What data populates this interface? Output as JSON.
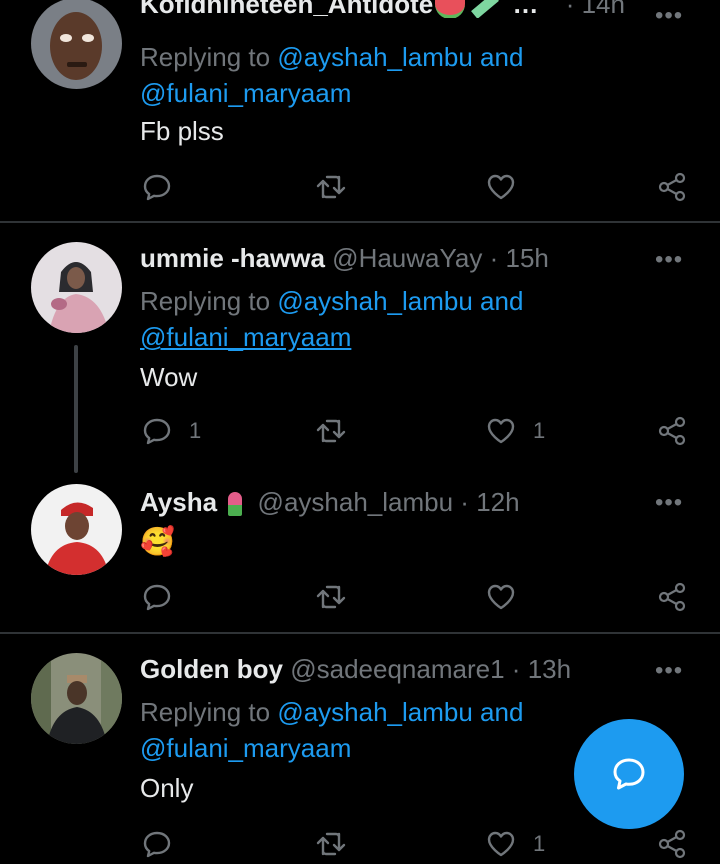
{
  "tweets": [
    {
      "name": "Kofidnineteen_Antidote",
      "handle": "…",
      "time": "14h",
      "replying_prefix": "Replying to",
      "replying_line1": "@ayshah_lambu and",
      "replying_line2": "@fulani_maryaam",
      "text": "Fb plss",
      "reply_count": "",
      "like_count": ""
    },
    {
      "name": "ummie -hawwa",
      "handle": "@HauwaYay",
      "time": "15h",
      "replying_prefix": "Replying to",
      "replying_line1": "@ayshah_lambu and",
      "replying_line2": "@fulani_maryaam",
      "text": "Wow",
      "reply_count": "1",
      "like_count": "1"
    },
    {
      "name": "Aysha",
      "handle": "@ayshah_lambu",
      "time": "12h",
      "text": "🥰",
      "reply_count": "",
      "like_count": ""
    },
    {
      "name": "Golden boy",
      "handle": "@sadeeqnamare1",
      "time": "13h",
      "replying_prefix": "Replying to",
      "replying_line1": "@ayshah_lambu and",
      "replying_line2": "@fulani_maryaam",
      "text": "Only",
      "reply_count": "",
      "like_count": "1"
    }
  ],
  "separator": "·",
  "more_label": "•••",
  "colors": {
    "background": "#000000",
    "accent": "#1d9bf0",
    "muted": "#71767b",
    "divider": "#2f3336"
  },
  "icons": [
    "reply-icon",
    "retweet-icon",
    "like-icon",
    "share-icon",
    "compose-reply-icon"
  ]
}
